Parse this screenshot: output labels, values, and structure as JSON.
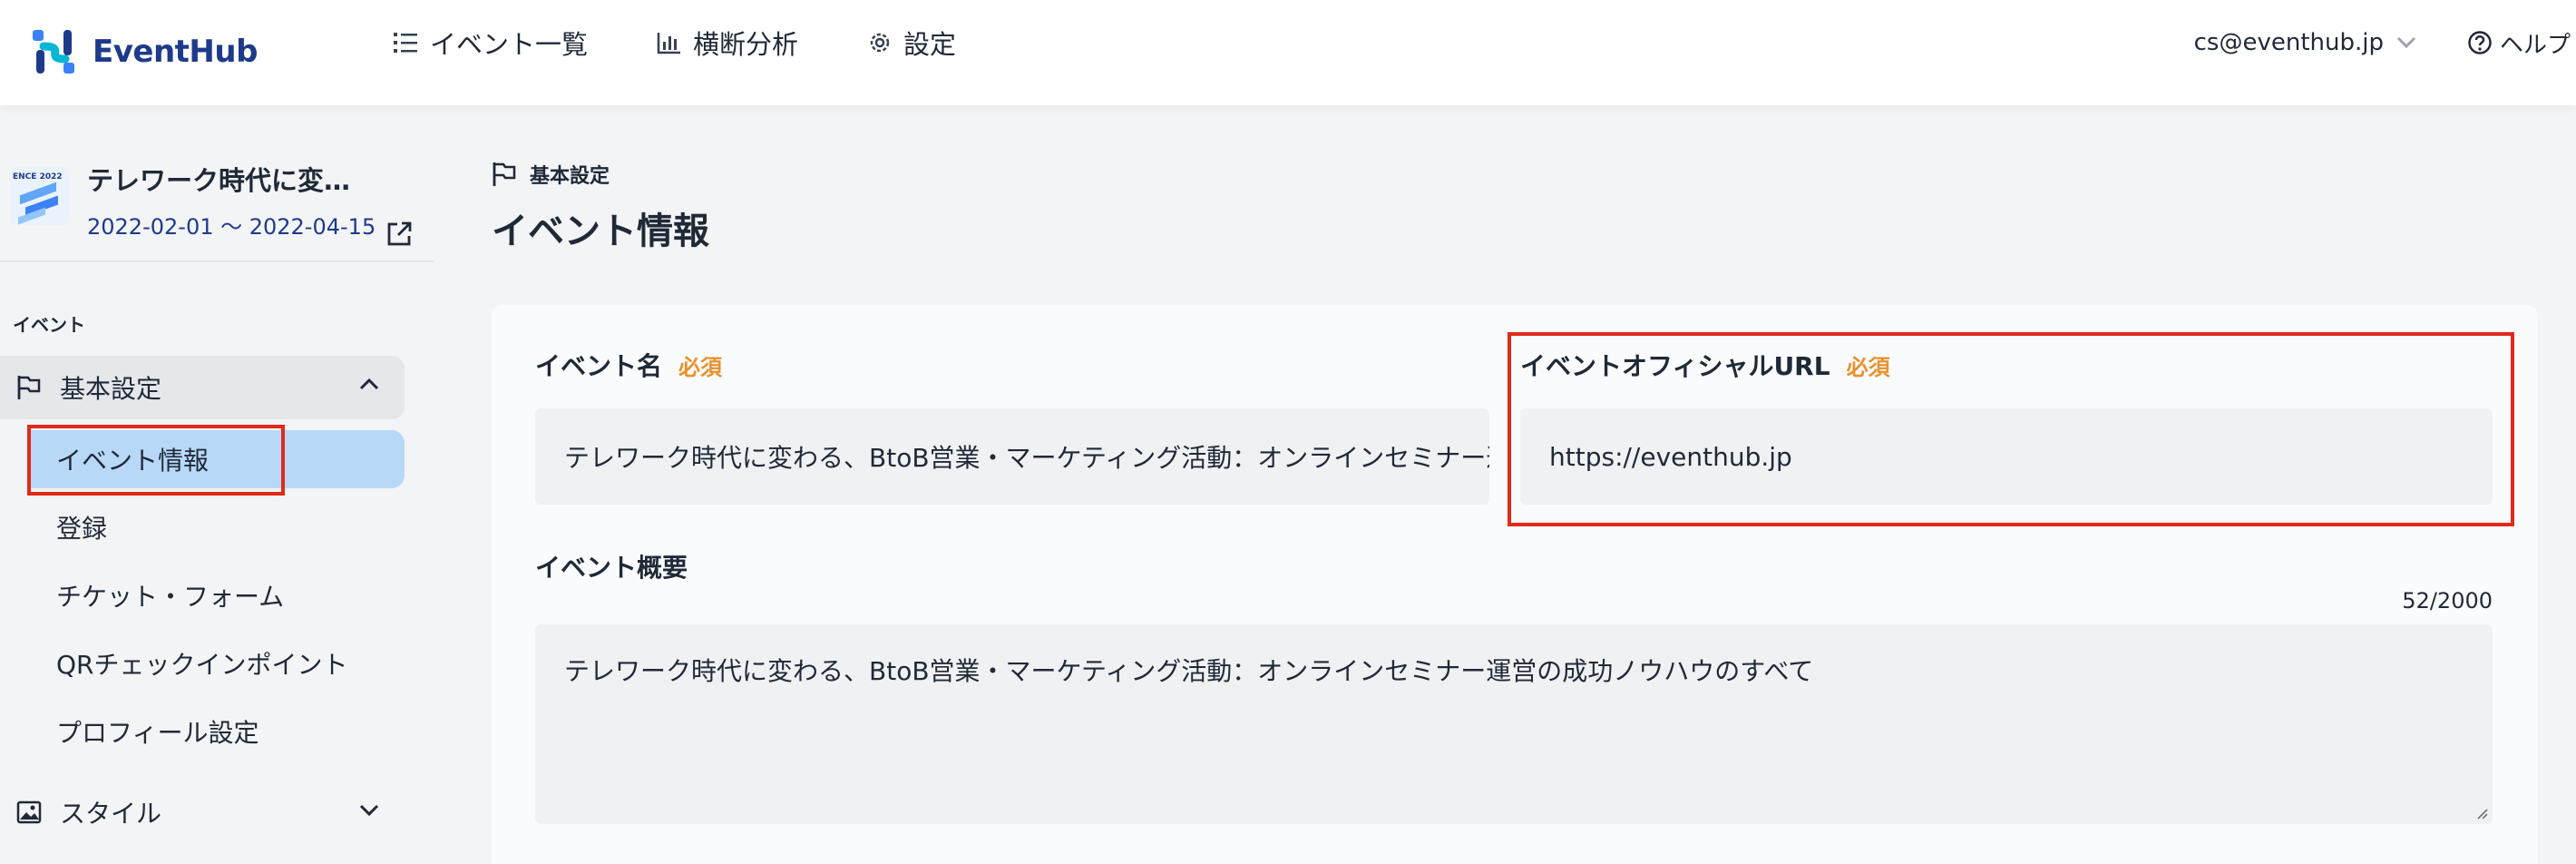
{
  "app": {
    "name": "EventHub",
    "brand_color": "#1e3a8a",
    "accent_color": "#3b82f6"
  },
  "nav": [
    {
      "label": "イベント一覧",
      "icon": "list-icon"
    },
    {
      "label": "横断分析",
      "icon": "bar-chart-icon"
    },
    {
      "label": "設定",
      "icon": "gear-icon"
    }
  ],
  "account": {
    "email": "cs@eventhub.jp",
    "help_label": "ヘルプ"
  },
  "event": {
    "name": "テレワーク時代に変…",
    "dates": "2022-02-01 〜 2022-04-15",
    "thumbnail_text": "ENCE 2022"
  },
  "sidebar": {
    "section_label": "イベント",
    "group_basic": "基本設定",
    "items": [
      {
        "label": "イベント情報",
        "active": true
      },
      {
        "label": "登録"
      },
      {
        "label": "チケット・フォーム"
      },
      {
        "label": "QRチェックインポイント"
      },
      {
        "label": "プロフィール設定"
      }
    ],
    "group_style": "スタイル"
  },
  "page": {
    "breadcrumb": "基本設定",
    "title": "イベント情報"
  },
  "form": {
    "required_label": "必須",
    "event_name": {
      "label": "イベント名",
      "value": "テレワーク時代に変わる、BtoB営業・マーケティング活動：オンラインセミナー運営の成功ノウハウのすべて"
    },
    "official_url": {
      "label": "イベントオフィシャルURL",
      "value": "https://eventhub.jp"
    },
    "summary": {
      "label": "イベント概要",
      "counter": "52/2000",
      "value": "テレワーク時代に変わる、BtoB営業・マーケティング活動：オンラインセミナー運営の成功ノウハウのすべて"
    }
  },
  "highlight_color": "#e02a1a"
}
